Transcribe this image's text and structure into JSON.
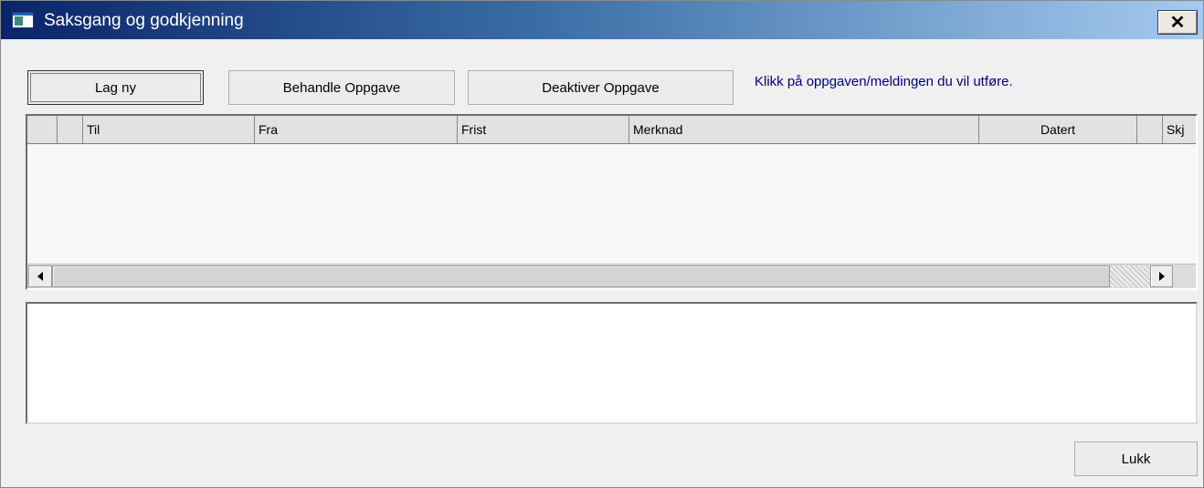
{
  "window": {
    "title": "Saksgang og godkjenning",
    "close_symbol": "✕"
  },
  "toolbar": {
    "new_label": "Lag ny",
    "process_label": "Behandle Oppgave",
    "deactivate_label": "Deaktiver Oppgave",
    "hint": "Klikk på oppgaven/meldingen du vil  utføre."
  },
  "grid": {
    "columns": [
      "",
      "",
      "Til",
      "Fra",
      "Frist",
      "Merknad",
      "Datert",
      "",
      "Skj"
    ],
    "rows": []
  },
  "scrollbar": {
    "left_arrow": "◄",
    "right_arrow": "►"
  },
  "memo": {
    "text": ""
  },
  "footer": {
    "close_label": "Lukk"
  },
  "colors": {
    "title_gradient_start": "#0a246a",
    "title_gradient_end": "#a6caf0",
    "hint_text": "#00007f",
    "window_bg": "#f0f0f0"
  },
  "icons": {
    "app": "window-app-icon",
    "close": "close-icon",
    "scroll_left": "arrow-left-icon",
    "scroll_right": "arrow-right-icon"
  }
}
